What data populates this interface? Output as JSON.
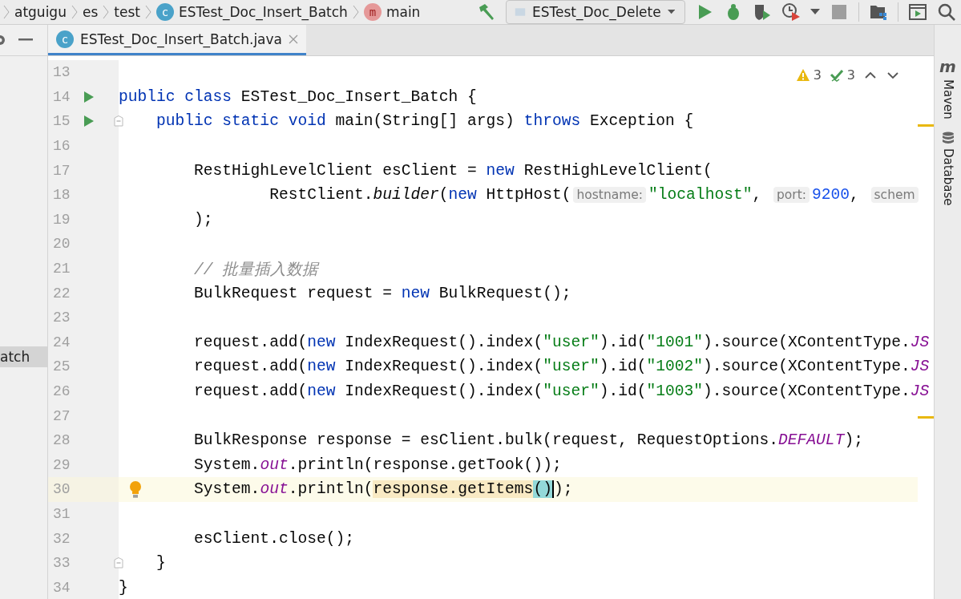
{
  "breadcrumbs": [
    {
      "label": "atguigu",
      "icon": {
        "kind": "dir"
      }
    },
    {
      "label": "es",
      "icon": {
        "kind": "dir"
      }
    },
    {
      "label": "test",
      "icon": {
        "kind": "dir"
      }
    },
    {
      "label": "ESTest_Doc_Insert_Batch",
      "icon": {
        "kind": "class",
        "glyph": "c"
      }
    },
    {
      "label": "main",
      "icon": {
        "kind": "method",
        "glyph": "m"
      }
    }
  ],
  "run_config": {
    "label": "ESTest_Doc_Delete"
  },
  "tabs": [
    {
      "label": "ESTest_Doc_Insert_Batch.java",
      "icon_glyph": "c",
      "selected": true
    }
  ],
  "project_panel": {
    "items": [
      {
        "label": "atch",
        "selected": true
      }
    ]
  },
  "inspections": {
    "warnings": "3",
    "weak_warnings": "3"
  },
  "tool_windows": [
    {
      "label": "Maven",
      "icon": {
        "kind": "maven",
        "glyph": "m"
      }
    },
    {
      "label": "Database",
      "icon": {
        "kind": "database"
      }
    }
  ],
  "lines": [
    {
      "number": "13",
      "current": false
    },
    {
      "number": "14",
      "gutter": [
        {
          "kind": "run"
        }
      ],
      "current": false,
      "tokens": [
        {
          "text": "public class ",
          "kind": "kw"
        },
        {
          "text": "ESTest_Doc_Insert_Batch {",
          "kind": "plain"
        }
      ]
    },
    {
      "number": "15",
      "gutter": [
        {
          "kind": "run"
        },
        {
          "kind": "fold"
        }
      ],
      "current": false,
      "tokens": [
        {
          "text": "    public static void ",
          "kind": "kw"
        },
        {
          "text": "main(String[] args) ",
          "kind": "plain"
        },
        {
          "text": "throws ",
          "kind": "kw"
        },
        {
          "text": "Exception {",
          "kind": "plain"
        }
      ]
    },
    {
      "number": "16",
      "current": false
    },
    {
      "number": "17",
      "current": false,
      "tokens": [
        {
          "text": "        RestHighLevelClient esClient = ",
          "kind": "plain"
        },
        {
          "text": "new ",
          "kind": "kw"
        },
        {
          "text": "RestHighLevelClient(",
          "kind": "plain"
        }
      ]
    },
    {
      "number": "18",
      "current": false,
      "tokens": [
        {
          "text": "                RestClient.",
          "kind": "plain"
        },
        {
          "text": "builder",
          "kind": "static"
        },
        {
          "text": "(",
          "kind": "plain"
        },
        {
          "text": "new ",
          "kind": "kw"
        },
        {
          "text": "HttpHost(",
          "kind": "plain"
        },
        {
          "text": "hostname:",
          "kind": "hint"
        },
        {
          "text": "\"localhost\"",
          "kind": "str"
        },
        {
          "text": ", ",
          "kind": "plain"
        },
        {
          "text": "port:",
          "kind": "hint"
        },
        {
          "text": "9200",
          "kind": "num"
        },
        {
          "text": ", ",
          "kind": "plain"
        },
        {
          "text": "schem",
          "kind": "hint"
        }
      ]
    },
    {
      "number": "19",
      "current": false,
      "tokens": [
        {
          "text": "        );",
          "kind": "plain"
        }
      ]
    },
    {
      "number": "20",
      "current": false
    },
    {
      "number": "21",
      "current": false,
      "tokens": [
        {
          "text": "        // 批量插入数据",
          "kind": "comment"
        }
      ]
    },
    {
      "number": "22",
      "current": false,
      "tokens": [
        {
          "text": "        BulkRequest request = ",
          "kind": "plain"
        },
        {
          "text": "new ",
          "kind": "kw"
        },
        {
          "text": "BulkRequest();",
          "kind": "plain"
        }
      ]
    },
    {
      "number": "23",
      "current": false
    },
    {
      "number": "24",
      "current": false,
      "tokens": [
        {
          "text": "        request.add(",
          "kind": "plain"
        },
        {
          "text": "new ",
          "kind": "kw"
        },
        {
          "text": "IndexRequest().index(",
          "kind": "plain"
        },
        {
          "text": "\"user\"",
          "kind": "str"
        },
        {
          "text": ").id(",
          "kind": "plain"
        },
        {
          "text": "\"1001\"",
          "kind": "str"
        },
        {
          "text": ").source(XContentType.",
          "kind": "plain"
        },
        {
          "text": "JS",
          "kind": "field"
        }
      ]
    },
    {
      "number": "25",
      "current": false,
      "tokens": [
        {
          "text": "        request.add(",
          "kind": "plain"
        },
        {
          "text": "new ",
          "kind": "kw"
        },
        {
          "text": "IndexRequest().index(",
          "kind": "plain"
        },
        {
          "text": "\"user\"",
          "kind": "str"
        },
        {
          "text": ").id(",
          "kind": "plain"
        },
        {
          "text": "\"1002\"",
          "kind": "str"
        },
        {
          "text": ").source(XContentType.",
          "kind": "plain"
        },
        {
          "text": "JS",
          "kind": "field"
        }
      ]
    },
    {
      "number": "26",
      "current": false,
      "tokens": [
        {
          "text": "        request.add(",
          "kind": "plain"
        },
        {
          "text": "new ",
          "kind": "kw"
        },
        {
          "text": "IndexRequest().index(",
          "kind": "plain"
        },
        {
          "text": "\"user\"",
          "kind": "str"
        },
        {
          "text": ").id(",
          "kind": "plain"
        },
        {
          "text": "\"1003\"",
          "kind": "str"
        },
        {
          "text": ").source(XContentType.",
          "kind": "plain"
        },
        {
          "text": "JS",
          "kind": "field"
        }
      ]
    },
    {
      "number": "27",
      "current": false
    },
    {
      "number": "28",
      "current": false,
      "tokens": [
        {
          "text": "        BulkResponse response = esClient.bulk(request, RequestOptions.",
          "kind": "plain"
        },
        {
          "text": "DEFAULT",
          "kind": "field"
        },
        {
          "text": ");",
          "kind": "plain"
        }
      ]
    },
    {
      "number": "29",
      "current": false,
      "tokens": [
        {
          "text": "        System.",
          "kind": "plain"
        },
        {
          "text": "out",
          "kind": "field"
        },
        {
          "text": ".println(response.getTook());",
          "kind": "plain"
        }
      ]
    },
    {
      "number": "30",
      "gutter": [
        {
          "kind": "bulb"
        }
      ],
      "current": true,
      "tokens": [
        {
          "text": "        System.",
          "kind": "plain"
        },
        {
          "text": "out",
          "kind": "field"
        },
        {
          "text": ".println(",
          "kind": "plain"
        },
        {
          "text": "response.getItems",
          "kind": "match"
        },
        {
          "text": "()",
          "kind": "brace"
        },
        {
          "text": ");",
          "kind": "plain"
        }
      ]
    },
    {
      "number": "31",
      "current": false
    },
    {
      "number": "32",
      "current": false,
      "tokens": [
        {
          "text": "        esClient.close();",
          "kind": "plain"
        }
      ]
    },
    {
      "number": "33",
      "gutter": [
        {
          "kind": "fold"
        }
      ],
      "current": false,
      "tokens": [
        {
          "text": "    }",
          "kind": "plain"
        }
      ]
    },
    {
      "number": "34",
      "current": false,
      "tokens": [
        {
          "text": "}",
          "kind": "plain"
        }
      ]
    }
  ]
}
